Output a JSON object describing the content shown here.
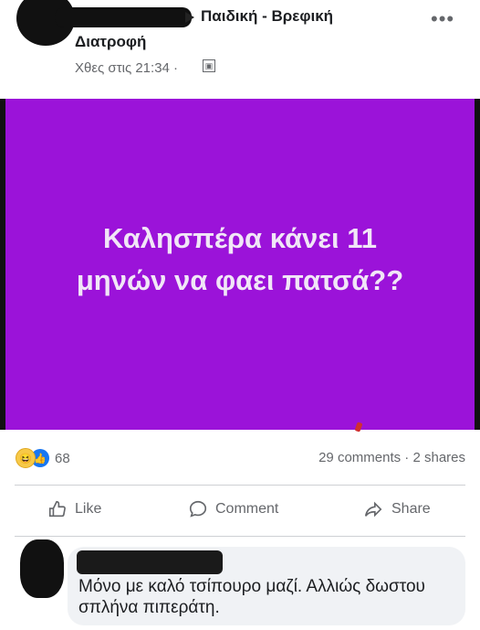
{
  "post": {
    "group_line1": "Παιδική - Βρεφική",
    "group_line2": "Διατροφή",
    "timestamp": "Χθες στις 21:34 ·",
    "more_glyph": "•••",
    "text_line1": "Καλησπέρα κάνει 11",
    "text_line2": "μηνών να φαει πατσά??",
    "background_color": "#9b13d9"
  },
  "stats": {
    "reaction_count": "68",
    "comments_shares": "29 comments · 2 shares"
  },
  "actions": {
    "like": "Like",
    "comment": "Comment",
    "share": "Share"
  },
  "comment": {
    "text": "Μόνο με καλό τσίπουρο μαζί. Αλλιώς δωστου σπλήνα πιπεράτη."
  }
}
